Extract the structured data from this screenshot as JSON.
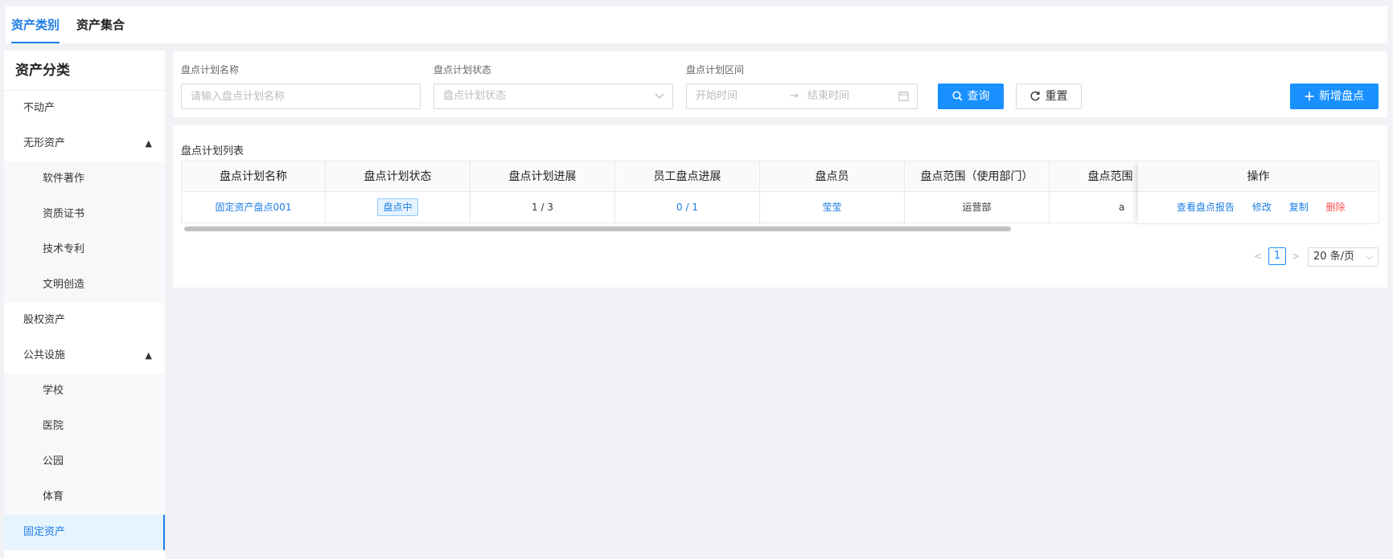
{
  "tabs": [
    {
      "label": "资产类别",
      "active": true
    },
    {
      "label": "资产集合",
      "active": false
    }
  ],
  "sidebar": {
    "title": "资产分类",
    "items": [
      {
        "label": "不动产"
      },
      {
        "label": "无形资产",
        "expanded": true
      },
      {
        "label": "软件著作"
      },
      {
        "label": "资质证书"
      },
      {
        "label": "技术专利"
      },
      {
        "label": "文明创造"
      },
      {
        "label": "股权资产"
      },
      {
        "label": "公共设施",
        "expanded": true
      },
      {
        "label": "学校"
      },
      {
        "label": "医院"
      },
      {
        "label": "公园"
      },
      {
        "label": "体育"
      },
      {
        "label": "固定资产",
        "selected": true
      }
    ]
  },
  "filter": {
    "name_label": "盘点计划名称",
    "name_placeholder": "请输入盘点计划名称",
    "status_label": "盘点计划状态",
    "status_placeholder": "盘点计划状态",
    "range_label": "盘点计划区间",
    "start_placeholder": "开始时间",
    "end_placeholder": "结束时间",
    "search_button": "查询",
    "reset_button": "重置",
    "add_button": "新增盘点"
  },
  "list": {
    "title": "盘点计划列表",
    "columns": [
      "盘点计划名称",
      "盘点计划状态",
      "盘点计划进展",
      "员工盘点进展",
      "盘点员",
      "盘点范围（使用部门）",
      "盘点范围（资"
    ],
    "actions_header": "操作",
    "rows": [
      {
        "name": "固定资产盘点001",
        "status": "盘点中",
        "plan_progress": "1 / 3",
        "staff_progress": "0 / 1",
        "checker": "莹莹",
        "dept": "运营部",
        "scope": "a",
        "actions": {
          "view": "查看盘点报告",
          "edit": "修改",
          "copy": "复制",
          "delete": "删除"
        }
      }
    ]
  },
  "pagination": {
    "current_page": "1",
    "page_size": "20 条/页"
  },
  "colors": {
    "accent": "#1890ff",
    "danger": "#ff4d4f",
    "selected_bg": "#e6f4ff"
  }
}
